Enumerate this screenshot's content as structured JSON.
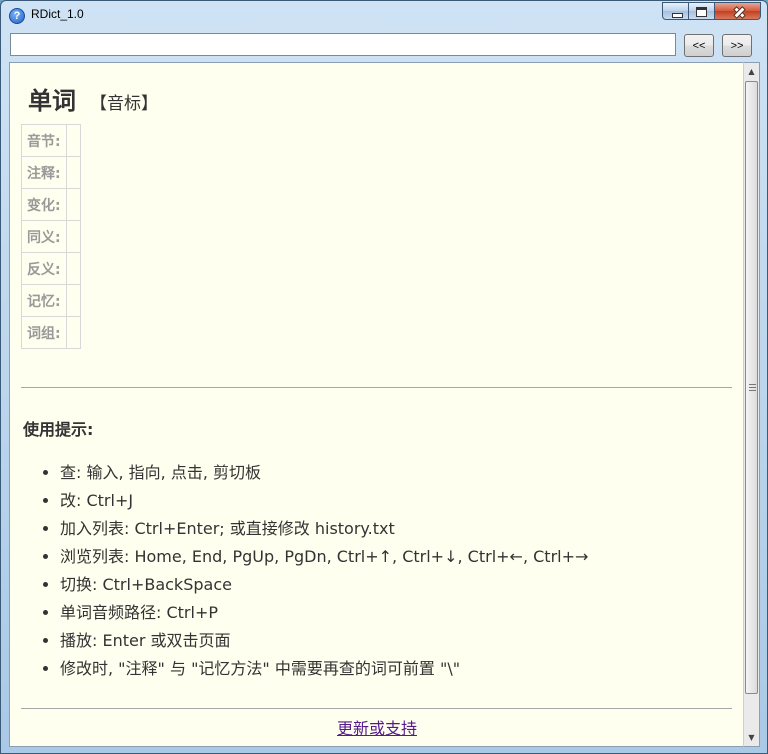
{
  "window": {
    "title": "RDict_1.0",
    "app_icon": "?"
  },
  "toolbar": {
    "search_value": "",
    "prev_label": "<<",
    "next_label": ">>"
  },
  "entry": {
    "word": "单词",
    "phonetic": "【音标】",
    "fields": [
      {
        "label": "音节:",
        "value": ""
      },
      {
        "label": "注释:",
        "value": ""
      },
      {
        "label": "变化:",
        "value": ""
      },
      {
        "label": "同义:",
        "value": ""
      },
      {
        "label": "反义:",
        "value": ""
      },
      {
        "label": "记忆:",
        "value": ""
      },
      {
        "label": "词组:",
        "value": ""
      }
    ]
  },
  "tips": {
    "title": "使用提示:",
    "items": [
      "查: 输入, 指向, 点击, 剪切板",
      "改: Ctrl+J",
      "加入列表: Ctrl+Enter; 或直接修改 history.txt",
      "浏览列表: Home, End, PgUp, PgDn, Ctrl+↑, Ctrl+↓, Ctrl+←, Ctrl+→",
      "切换: Ctrl+BackSpace",
      "单词音频路径: Ctrl+P",
      "播放: Enter 或双击页面",
      "修改时, \"注释\" 与 \"记忆方法\" 中需要再查的词可前置 \"\\\""
    ]
  },
  "footer": {
    "link_text": "更新或支持"
  },
  "colors": {
    "content_bg": "#fffff0",
    "link": "#551a8b",
    "label_gray": "#999999"
  }
}
